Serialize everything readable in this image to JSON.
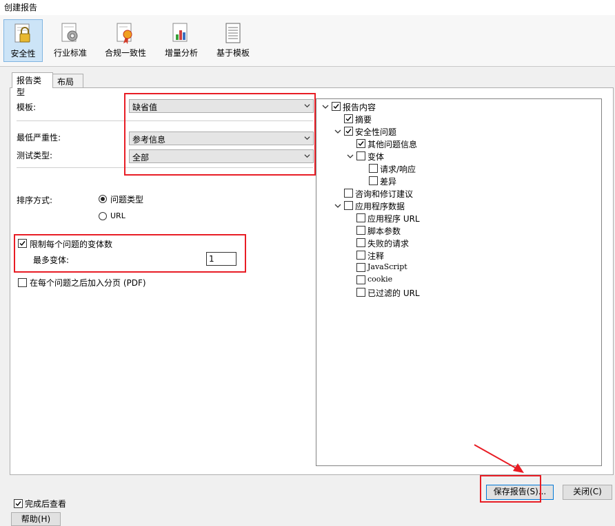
{
  "window": {
    "title": "创建报告"
  },
  "toolbar": {
    "items": [
      {
        "label": "安全性"
      },
      {
        "label": "行业标准"
      },
      {
        "label": "合规一致性"
      },
      {
        "label": "增量分析"
      },
      {
        "label": "基于模板"
      }
    ]
  },
  "tabs": [
    {
      "label": "报告类型"
    },
    {
      "label": "布局"
    }
  ],
  "form": {
    "template_label": "模板:",
    "template_value": "缺省值",
    "min_severity_label": "最低严重性:",
    "min_severity_value": "参考信息",
    "test_type_label": "测试类型:",
    "test_type_value": "全部",
    "sort_label": "排序方式:",
    "sort_options": [
      {
        "label": "问题类型",
        "selected": true
      },
      {
        "label": "URL",
        "selected": false
      }
    ],
    "limit_variants_label": "限制每个问题的变体数",
    "limit_variants_checked": true,
    "max_variants_label": "最多变体:",
    "max_variants_value": "1",
    "page_break_label": "在每个问题之后加入分页 (PDF)",
    "page_break_checked": false
  },
  "tree": {
    "items": [
      {
        "label": "报告内容",
        "checked": true,
        "expandable": true
      },
      {
        "label": "摘要",
        "checked": true
      },
      {
        "label": "安全性问题",
        "checked": true,
        "expandable": true
      },
      {
        "label": "其他问题信息",
        "checked": true
      },
      {
        "label": "变体",
        "checked": false,
        "expandable": true
      },
      {
        "label": "请求/响应",
        "checked": false
      },
      {
        "label": "差异",
        "checked": false
      },
      {
        "label": "咨询和修订建议",
        "checked": false
      },
      {
        "label": "应用程序数据",
        "checked": false,
        "expandable": true
      },
      {
        "label": "应用程序 URL",
        "checked": false
      },
      {
        "label": "脚本参数",
        "checked": false
      },
      {
        "label": "失败的请求",
        "checked": false
      },
      {
        "label": "注释",
        "checked": false
      },
      {
        "label": "JavaScript",
        "checked": false
      },
      {
        "label": "cookie",
        "checked": false
      },
      {
        "label": "已过滤的 URL",
        "checked": false
      }
    ]
  },
  "footer": {
    "view_after_label": "完成后查看",
    "view_after_checked": true,
    "save_label": "保存报告(S)...",
    "close_label": "关闭(C)",
    "help_label": "帮助(H)"
  },
  "colors": {
    "highlight": "#e81c24",
    "selected_tool": "#cce4f7"
  }
}
